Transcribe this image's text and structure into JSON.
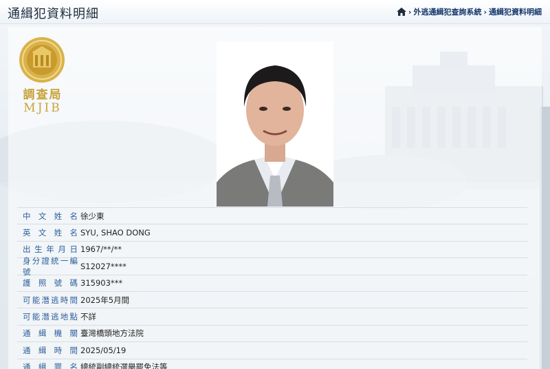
{
  "header": {
    "title": "通緝犯資料明細",
    "breadcrumb": [
      {
        "label": "外逃通緝犯查詢系統"
      },
      {
        "label": "通緝犯資料明細"
      }
    ]
  },
  "logo": {
    "cn": "調查局",
    "en": "MJIB",
    "color": "#c9a23a"
  },
  "record": [
    {
      "label": "中文姓名",
      "value": "徐少東"
    },
    {
      "label": "英文姓名",
      "value": "SYU, SHAO DONG"
    },
    {
      "label": "出生年月日",
      "value": "1967/**/**"
    },
    {
      "label": "身分證統一編號",
      "value": "S12027****"
    },
    {
      "label": "護照號碼",
      "value": "315903***"
    },
    {
      "label": "可能潛逃時間",
      "value": "2025年5月間"
    },
    {
      "label": "可能潛逃地點",
      "value": "不詳"
    },
    {
      "label": "通緝機關",
      "value": "臺灣橋頭地方法院"
    },
    {
      "label": "通緝時間",
      "value": "2025/05/19"
    },
    {
      "label": "通緝罪名",
      "value": "總統副總統選舉罷免法等"
    }
  ]
}
